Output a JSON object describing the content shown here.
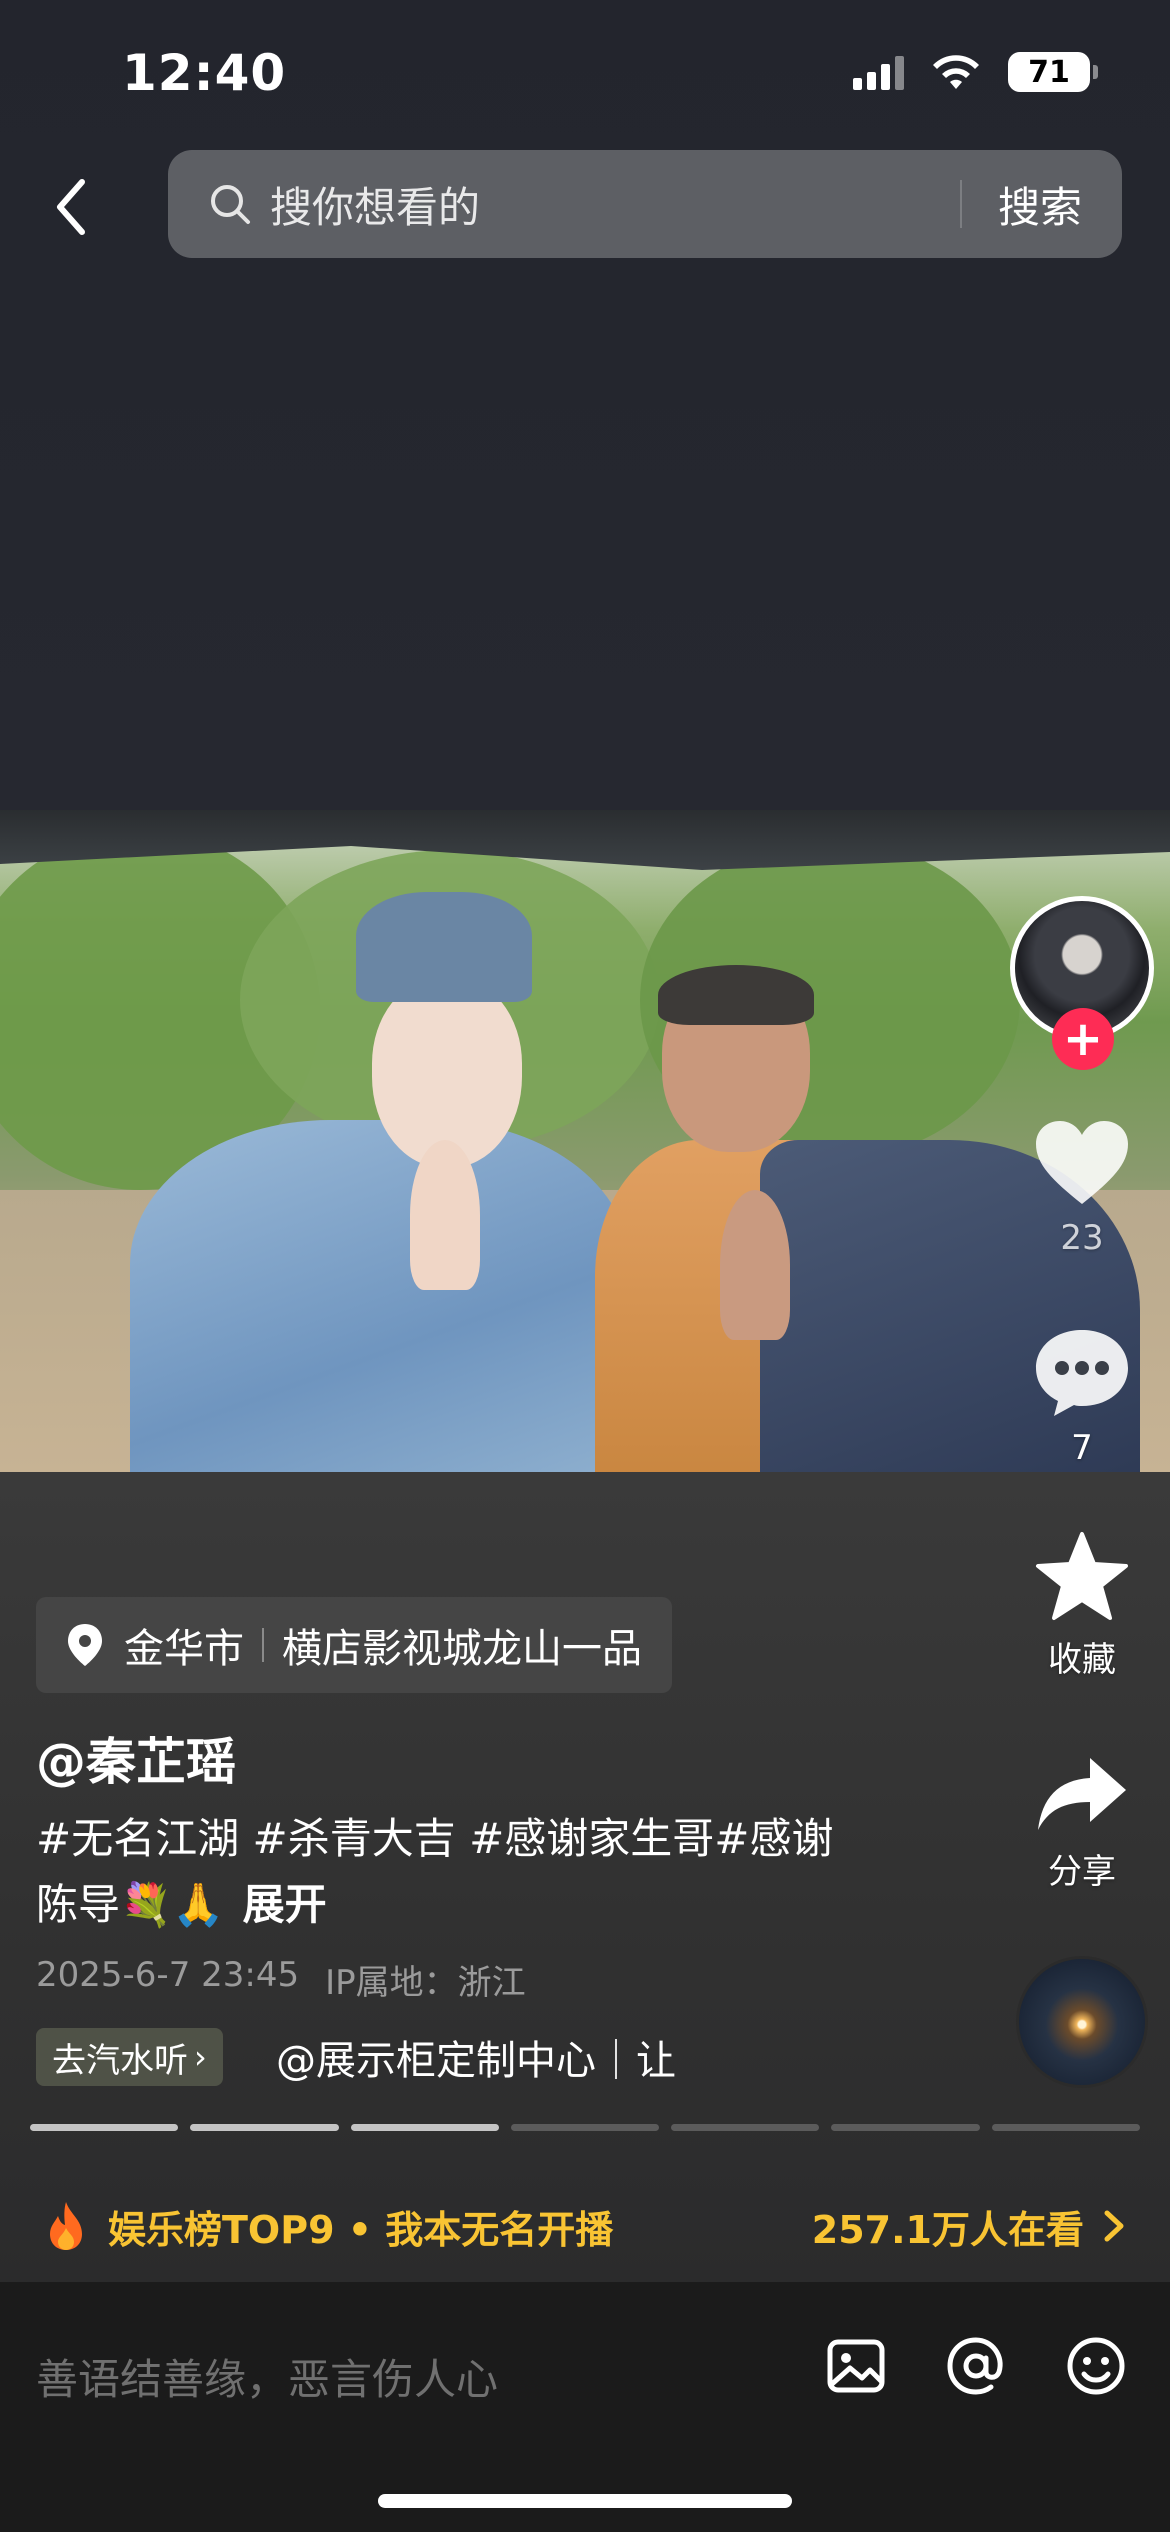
{
  "status_bar": {
    "time": "12:40",
    "battery": "71"
  },
  "search": {
    "placeholder": "搜你想看的",
    "button": "搜索"
  },
  "rail": {
    "like_count": "23",
    "comment_count": "7",
    "favorite_label": "收藏",
    "share_label": "分享"
  },
  "post": {
    "location_city": "金华市",
    "location_place": "横店影视城龙山一品",
    "username": "@秦芷瑶",
    "caption_line1": "#无名江湖 #杀青大吉 #感谢家生哥#感谢",
    "caption_line2": "陈导💐🙏",
    "expand": "展开",
    "date": "2025-6-7 23:45",
    "ip": "IP属地：浙江",
    "tag_chip": "去汽水听",
    "mention": "@展示柜定制中心｜让"
  },
  "progress": {
    "segments": 7,
    "active": 3
  },
  "banner": {
    "text": "娱乐榜TOP9 • 我本无名开播",
    "count": "257.1万人在看"
  },
  "comment": {
    "placeholder": "善语结善缘，恶言伤人心"
  },
  "colors": {
    "accent_red": "#fe2c55",
    "banner_gold": "#f9c433"
  }
}
